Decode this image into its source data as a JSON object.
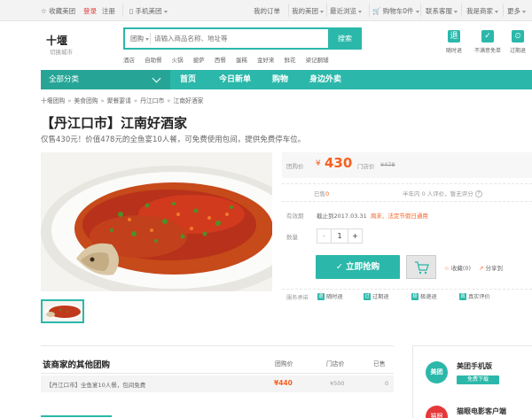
{
  "topbar": {
    "favorite": "收藏美团",
    "login": "登录",
    "register": "注册",
    "mobile": "手机美团",
    "orders": "我的订单",
    "my_meituan": "我的美团",
    "recent": "最近浏览",
    "cart": "购物车0件",
    "service": "联系客服",
    "merchant": "我是商家",
    "more": "更多"
  },
  "header": {
    "city": "十堰",
    "switch_city": "切换城市",
    "search_category": "团购",
    "search_placeholder": "请输入商品名称、地址等",
    "search_button": "搜索",
    "hot_links": [
      "酒店",
      "自助餐",
      "火锅",
      "披萨",
      "西餐",
      "蛋糕",
      "金好来",
      "鲜花",
      "梁记胴辅"
    ],
    "icons": [
      {
        "label": "随时退",
        "icon": "refund-icon"
      },
      {
        "label": "不满意免单",
        "icon": "check-icon"
      },
      {
        "label": "过期退",
        "icon": "expire-refund-icon"
      }
    ]
  },
  "nav": {
    "all_categories": "全部分类",
    "items": [
      "首页",
      "今日新单",
      "购物",
      "身边外卖"
    ]
  },
  "breadcrumb": [
    "十堰团购",
    "美食团购",
    "聚餐宴请",
    "丹江口市",
    "江南好酒家"
  ],
  "deal": {
    "title": "【丹江口市】江南好酒家",
    "description": "仅售430元！价值478元的全鱼宴10人餐，可免费使用包间，提供免费停车位。",
    "price_label": "团购价",
    "currency": "¥",
    "price": "430",
    "original_label": "门店价",
    "original_price": "¥478",
    "sold_prefix": "已售",
    "sold_count": "0",
    "rating_text": "半年内 0 人评价，暂无评分",
    "validity_label": "有效期",
    "validity_text": "截止到2017.03.31",
    "validity_note": "周末、法定节假日通用",
    "quantity_label": "数量",
    "quantity": "1",
    "minus": "-",
    "plus": "+",
    "buy_button": "立即抢购",
    "favorite": "收藏(0)",
    "share": "分享到"
  },
  "guarantee": {
    "label": "服务承诺",
    "items": [
      "随时退",
      "过期退",
      "极速退",
      "真实评价"
    ]
  },
  "other_deals": {
    "title": "该商家的其他团购",
    "columns": [
      "团购价",
      "门店价",
      "已售"
    ],
    "rows": [
      {
        "name": "【丹江口市】全鱼宴10人餐，包间免费",
        "price": "¥440",
        "original": "¥500",
        "sold": "0"
      }
    ]
  },
  "side": {
    "app1_icon": "美团",
    "app1_name": "美团手机版",
    "app1_button": "免费下载",
    "app2_icon": "猫眼",
    "app2_name": "猫眼电影客户端"
  }
}
